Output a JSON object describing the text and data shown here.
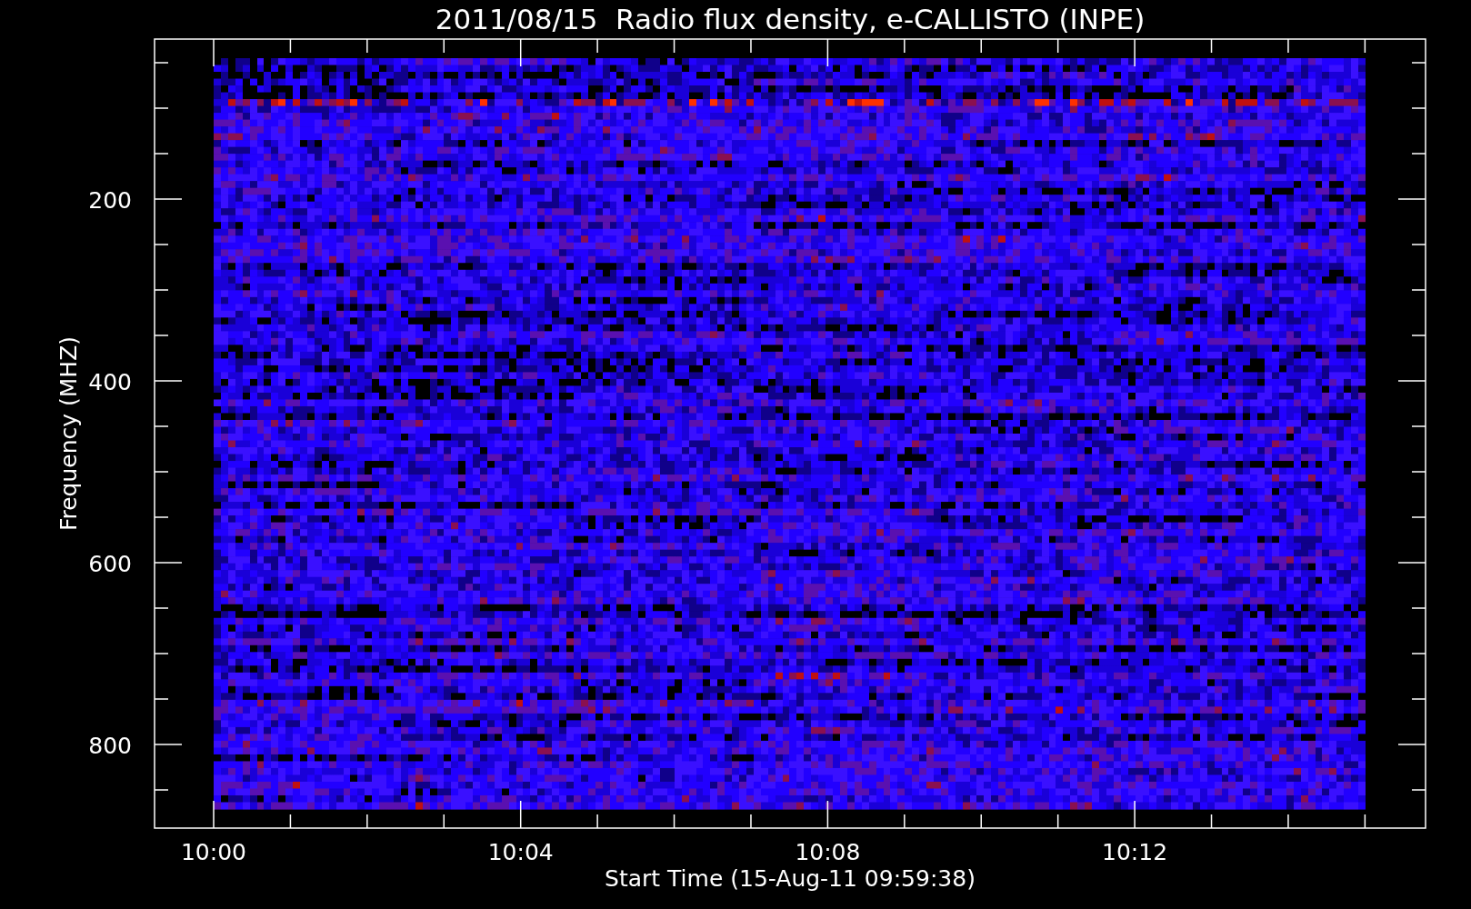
{
  "title": "2011/08/15  Radio flux density, e-CALLISTO (INPE)",
  "y_axis": {
    "label": "Frequency (MHZ)",
    "ticks": [
      "200",
      "400",
      "600",
      "800"
    ]
  },
  "x_axis": {
    "label": "Start Time (15-Aug-11 09:59:38)",
    "ticks": [
      "10:00",
      "10:04",
      "10:08",
      "10:12"
    ]
  }
}
